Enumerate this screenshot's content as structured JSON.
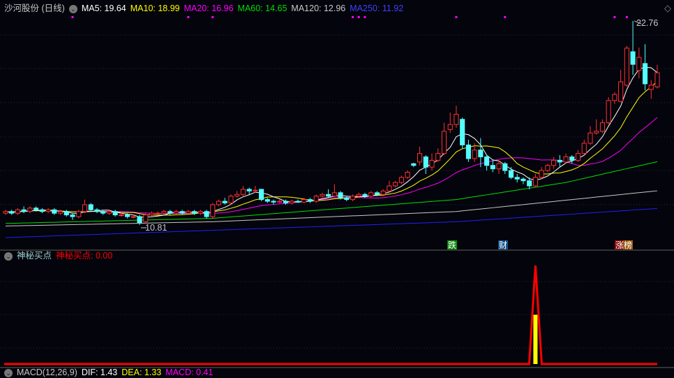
{
  "header": {
    "title": "沙河股份 (日线)",
    "ma5": "MA5: 19.64",
    "ma10": "MA10: 18.99",
    "ma20": "MA20: 16.96",
    "ma60": "MA60: 14.65",
    "ma120": "MA120: 12.96",
    "ma250": "MA250: 11.92"
  },
  "price_labels": {
    "high": "22.76",
    "low": "10.81"
  },
  "tags": [
    {
      "text": "跌",
      "color": "#0a8a0a"
    },
    {
      "text": "财",
      "color": "#14508a"
    },
    {
      "text": "涨",
      "color": "#8a0a0a"
    },
    {
      "text": "榜",
      "color": "#a05a10"
    }
  ],
  "indicator": {
    "name": "神秘买点",
    "value_label": "神秘买点: 0.00"
  },
  "macd": {
    "name": "MACD(12,26,9)",
    "dif": "DIF: 1.43",
    "dea": "DEA: 1.33",
    "macd": "MACD: 0.41"
  },
  "colors": {
    "up": "#ff3232",
    "down": "#54ffff",
    "ma5": "#ffffff",
    "ma10": "#ffff00",
    "ma20": "#ff00ff",
    "ma60": "#00e000",
    "ma120": "#c8c8c8",
    "ma250": "#2020ff"
  },
  "chart_data": {
    "type": "candlestick",
    "ylim": [
      10.81,
      22.76
    ],
    "candles": [
      [
        11.5,
        11.6,
        11.7,
        11.4
      ],
      [
        11.6,
        11.5,
        11.7,
        11.4
      ],
      [
        11.5,
        11.7,
        11.8,
        11.4
      ],
      [
        11.7,
        11.6,
        11.9,
        11.5
      ],
      [
        11.6,
        11.8,
        11.9,
        11.5
      ],
      [
        11.8,
        11.7,
        11.9,
        11.6
      ],
      [
        11.7,
        11.6,
        11.8,
        11.5
      ],
      [
        11.6,
        11.7,
        11.8,
        11.5
      ],
      [
        11.7,
        11.5,
        11.8,
        11.4
      ],
      [
        11.5,
        11.6,
        11.7,
        11.4
      ],
      [
        11.6,
        11.4,
        11.7,
        11.3
      ],
      [
        11.4,
        11.3,
        11.5,
        11.1
      ],
      [
        11.3,
        11.6,
        11.7,
        11.2
      ],
      [
        11.6,
        12.0,
        12.3,
        11.5
      ],
      [
        12.0,
        11.7,
        12.1,
        11.6
      ],
      [
        11.7,
        11.6,
        11.8,
        11.5
      ],
      [
        11.6,
        11.5,
        11.7,
        11.4
      ],
      [
        11.5,
        11.6,
        11.7,
        11.4
      ],
      [
        11.6,
        11.4,
        11.7,
        11.3
      ],
      [
        11.4,
        11.4,
        11.6,
        11.3
      ],
      [
        11.4,
        11.3,
        11.5,
        11.2
      ],
      [
        11.3,
        11.3,
        11.4,
        11.2
      ],
      [
        11.3,
        10.95,
        11.4,
        10.81
      ],
      [
        11.0,
        11.4,
        11.5,
        10.9
      ],
      [
        11.4,
        11.5,
        11.6,
        11.3
      ],
      [
        11.5,
        11.5,
        11.6,
        11.4
      ],
      [
        11.5,
        11.6,
        11.7,
        11.4
      ],
      [
        11.6,
        11.5,
        11.7,
        11.4
      ],
      [
        11.5,
        11.6,
        11.7,
        11.4
      ],
      [
        11.6,
        11.5,
        11.7,
        11.4
      ],
      [
        11.5,
        11.6,
        11.7,
        11.4
      ],
      [
        11.6,
        11.5,
        11.7,
        11.4
      ],
      [
        11.5,
        11.6,
        11.7,
        11.4
      ],
      [
        11.6,
        11.3,
        11.7,
        11.2
      ],
      [
        11.3,
        12.0,
        12.1,
        11.2
      ],
      [
        12.0,
        12.2,
        12.3,
        11.9
      ],
      [
        12.2,
        12.1,
        12.4,
        12.0
      ],
      [
        12.1,
        12.5,
        12.6,
        12.0
      ],
      [
        12.5,
        12.6,
        12.8,
        12.4
      ],
      [
        12.6,
        12.9,
        13.1,
        12.5
      ],
      [
        12.9,
        12.8,
        13.0,
        12.6
      ],
      [
        12.8,
        12.85,
        13.1,
        12.7
      ],
      [
        12.9,
        12.3,
        12.9,
        12.2
      ],
      [
        12.3,
        12.2,
        12.4,
        12.1
      ],
      [
        12.2,
        12.15,
        12.3,
        12.0
      ],
      [
        12.15,
        12.2,
        12.3,
        12.1
      ],
      [
        12.2,
        12.1,
        12.3,
        12.0
      ],
      [
        12.1,
        12.2,
        12.3,
        12.0
      ],
      [
        12.2,
        12.15,
        12.3,
        12.1
      ],
      [
        12.15,
        12.3,
        12.4,
        12.1
      ],
      [
        12.3,
        12.2,
        12.4,
        12.1
      ],
      [
        12.2,
        12.5,
        12.6,
        12.1
      ],
      [
        12.5,
        12.6,
        12.7,
        12.4
      ],
      [
        12.6,
        12.5,
        12.9,
        12.4
      ],
      [
        12.5,
        12.7,
        13.2,
        12.5
      ],
      [
        12.7,
        12.4,
        12.8,
        12.3
      ],
      [
        12.4,
        12.3,
        12.5,
        12.2
      ],
      [
        12.3,
        12.5,
        12.6,
        12.2
      ],
      [
        12.5,
        12.6,
        12.7,
        12.4
      ],
      [
        12.6,
        12.5,
        12.7,
        12.4
      ],
      [
        12.5,
        12.7,
        12.8,
        12.4
      ],
      [
        12.7,
        12.6,
        12.8,
        12.5
      ],
      [
        12.6,
        12.8,
        12.9,
        12.5
      ],
      [
        12.8,
        13.1,
        13.4,
        12.7
      ],
      [
        13.1,
        13.3,
        13.4,
        13.0
      ],
      [
        13.3,
        13.6,
        13.7,
        13.2
      ],
      [
        13.6,
        13.9,
        14.0,
        13.5
      ],
      [
        14.4,
        14.3,
        14.45,
        14.2
      ],
      [
        14.5,
        15.0,
        15.4,
        14.3
      ],
      [
        14.8,
        14.2,
        14.9,
        13.8
      ],
      [
        14.2,
        14.6,
        15.0,
        14.0
      ],
      [
        14.6,
        15.0,
        15.3,
        14.5
      ],
      [
        15.0,
        16.3,
        16.8,
        14.9
      ],
      [
        16.4,
        16.7,
        17.4,
        16.2
      ],
      [
        16.7,
        17.3,
        17.8,
        16.5
      ],
      [
        17.0,
        15.5,
        17.1,
        15.3
      ],
      [
        15.5,
        14.7,
        15.8,
        14.5
      ],
      [
        14.7,
        15.2,
        15.6,
        14.5
      ],
      [
        15.2,
        14.8,
        15.9,
        14.2
      ],
      [
        14.8,
        14.3,
        14.9,
        14.0
      ],
      [
        14.3,
        14.1,
        14.6,
        13.9
      ],
      [
        14.1,
        14.4,
        14.6,
        13.8
      ],
      [
        14.4,
        14.0,
        14.5,
        13.8
      ],
      [
        14.0,
        13.6,
        14.2,
        13.5
      ],
      [
        13.6,
        13.5,
        13.8,
        13.3
      ],
      [
        13.5,
        13.4,
        13.6,
        13.2
      ],
      [
        13.4,
        13.1,
        13.6,
        12.9
      ],
      [
        13.1,
        13.6,
        13.8,
        13.0
      ],
      [
        13.6,
        14.0,
        14.2,
        13.5
      ],
      [
        14.0,
        14.3,
        14.4,
        13.9
      ],
      [
        14.3,
        14.6,
        14.8,
        14.1
      ],
      [
        14.6,
        14.5,
        14.9,
        14.2
      ],
      [
        14.5,
        14.8,
        15.0,
        14.4
      ],
      [
        14.8,
        14.6,
        14.9,
        14.4
      ],
      [
        14.6,
        15.0,
        15.2,
        14.5
      ],
      [
        15.0,
        15.6,
        15.8,
        14.9
      ],
      [
        15.6,
        16.2,
        16.6,
        15.5
      ],
      [
        16.2,
        16.3,
        17.0,
        16.1
      ],
      [
        16.3,
        16.8,
        17.0,
        16.2
      ],
      [
        16.8,
        18.1,
        18.3,
        16.7
      ],
      [
        18.1,
        18.46,
        18.6,
        17.9
      ],
      [
        18.05,
        19.2,
        19.9,
        18.0
      ],
      [
        19.0,
        21.17,
        21.3,
        18.9
      ],
      [
        20.96,
        20.22,
        22.76,
        19.6
      ],
      [
        19.86,
        20.63,
        21.2,
        19.4
      ],
      [
        20.27,
        19.08,
        21.4,
        18.7
      ],
      [
        18.75,
        19.0,
        19.3,
        18.2
      ],
      [
        18.9,
        19.73,
        20.2,
        18.8
      ]
    ],
    "ma_long": {
      "ma60": [
        [
          0,
          10.9
        ],
        [
          34,
          11.2
        ],
        [
          74,
          12.3
        ],
        [
          92,
          13.3
        ],
        [
          108,
          14.6
        ]
      ],
      "ma120": [
        [
          0,
          10.75
        ],
        [
          34,
          11.0
        ],
        [
          74,
          11.6
        ],
        [
          108,
          12.85
        ]
      ],
      "ma250": [
        [
          0,
          10.07
        ],
        [
          34,
          10.5
        ],
        [
          74,
          11.0
        ],
        [
          108,
          11.8
        ]
      ]
    },
    "signal_index": 87,
    "signal_value": 1,
    "signal_bar": 0.5,
    "marker_indices": [
      11,
      30,
      34,
      57,
      58,
      59,
      74,
      82,
      100,
      102
    ]
  }
}
